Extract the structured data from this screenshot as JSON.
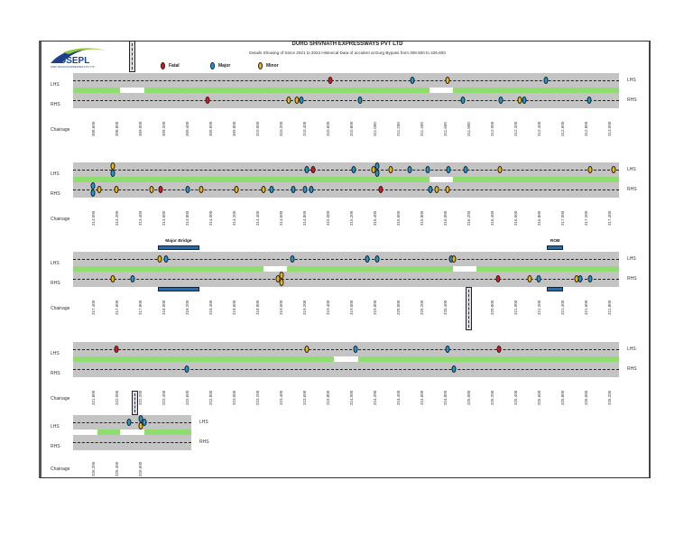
{
  "header": {
    "title": "DURG SHIVNATH EXPRESSWAYS PVT LTD",
    "subtitle": "Details Showing of Since 2021 to 2024 Historical Data of accident at Durg Bypass from 308.600 to 326.600",
    "logo_text": "DSEPL",
    "logo_tagline": "DURG SHIVNATH EXPRESSWAYS PVT LTD"
  },
  "legend": [
    {
      "key": "fatal",
      "label": "Fatal",
      "color": "#e8101e"
    },
    {
      "key": "major",
      "label": "Major",
      "color": "#1a9ad8"
    },
    {
      "key": "minor",
      "label": "Minor",
      "color": "#f2b900"
    }
  ],
  "labels": {
    "lhs": "LHS",
    "rhs": "RHS",
    "chainage": "Chainage"
  },
  "rows": [
    {
      "start": 308.6,
      "ticks": [
        "308.600",
        "308.800",
        "309.000",
        "309.200",
        "309.400",
        "309.600",
        "309.800",
        "310.000",
        "310.200",
        "310.400",
        "310.600",
        "310.800",
        "311.000",
        "311.200",
        "311.400",
        "311.600",
        "311.800",
        "312.000",
        "312.200",
        "312.400",
        "312.600",
        "312.800",
        "313.000"
      ],
      "median_openings": [
        [
          308.83,
          309.04
        ],
        [
          311.47,
          311.67
        ]
      ],
      "lhs": [
        [
          "fatal",
          310.62
        ],
        [
          "major",
          311.32
        ],
        [
          "minor",
          311.62
        ],
        [
          "major",
          312.46
        ]
      ],
      "rhs": [
        [
          "fatal",
          309.58
        ],
        [
          "minor",
          310.27
        ],
        [
          "minor",
          310.34
        ],
        [
          "major",
          310.38
        ],
        [
          "major",
          310.88
        ],
        [
          "major",
          311.75
        ],
        [
          "major",
          312.08
        ],
        [
          "minor",
          312.24
        ],
        [
          "major",
          312.28
        ],
        [
          "major",
          312.83
        ]
      ]
    },
    {
      "start": 313.0,
      "ticks": [
        "313.000",
        "313.200",
        "313.400",
        "313.600",
        "313.800",
        "314.000",
        "314.200",
        "314.400",
        "314.600",
        "314.800",
        "315.000",
        "315.200",
        "315.400",
        "315.600",
        "315.800",
        "316.000",
        "316.200",
        "316.400",
        "316.600",
        "316.800",
        "317.000",
        "317.200",
        "317.400"
      ],
      "median_openings": [
        [
          315.87,
          316.07
        ]
      ],
      "lhs": [
        [
          "minor",
          313.17
        ],
        [
          "major",
          313.17
        ],
        [
          "major",
          314.82
        ],
        [
          "fatal",
          314.88
        ],
        [
          "major",
          315.22
        ],
        [
          "minor",
          315.39
        ],
        [
          "major",
          315.42
        ],
        [
          "major",
          315.42
        ],
        [
          "minor",
          315.54
        ],
        [
          "major",
          315.7
        ],
        [
          "major",
          315.85
        ],
        [
          "major",
          316.03
        ],
        [
          "major",
          316.18
        ],
        [
          "minor",
          316.47
        ],
        [
          "minor",
          317.24
        ],
        [
          "minor",
          317.44
        ]
      ],
      "rhs": [
        [
          "major",
          313.0
        ],
        [
          "major",
          313.0
        ],
        [
          "minor",
          313.05
        ],
        [
          "minor",
          313.2
        ],
        [
          "minor",
          313.5
        ],
        [
          "fatal",
          313.58
        ],
        [
          "major",
          313.81
        ],
        [
          "minor",
          313.92
        ],
        [
          "minor",
          314.22
        ],
        [
          "minor",
          314.45
        ],
        [
          "major",
          314.52
        ],
        [
          "major",
          314.71
        ],
        [
          "major",
          314.81
        ],
        [
          "major",
          314.86
        ],
        [
          "fatal",
          315.45
        ],
        [
          "major",
          315.88
        ],
        [
          "minor",
          315.93
        ],
        [
          "minor",
          316.02
        ]
      ]
    },
    {
      "start": 317.4,
      "ticks": [
        "317.400",
        "317.600",
        "317.800",
        "318.000",
        "318.200",
        "318.400",
        "318.600",
        "318.800",
        "319.000",
        "319.200",
        "319.400",
        "319.600",
        "319.800",
        "320.000",
        "320.200",
        "320.400",
        "320.600",
        "320.800",
        "321.000",
        "321.200",
        "321.400",
        "321.600",
        "321.800"
      ],
      "median_openings": [
        [
          318.85,
          319.05
        ],
        [
          320.47,
          320.67
        ]
      ],
      "structures": [
        {
          "label": "Major Bridge",
          "from": 317.95,
          "to": 318.31
        },
        {
          "label": "ROB",
          "from": 321.27,
          "to": 321.41
        }
      ],
      "lhs": [
        [
          "minor",
          317.97
        ],
        [
          "major",
          318.02
        ],
        [
          "major",
          319.1
        ],
        [
          "major",
          319.74
        ],
        [
          "major",
          319.82
        ],
        [
          "major",
          320.45
        ],
        [
          "minor",
          320.48
        ]
      ],
      "rhs": [
        [
          "minor",
          317.57
        ],
        [
          "major",
          317.74
        ],
        [
          "minor",
          318.98
        ],
        [
          "minor",
          319.01
        ],
        [
          "minor",
          319.01
        ],
        [
          "fatal",
          320.85
        ],
        [
          "minor",
          321.12
        ],
        [
          "major",
          321.2
        ],
        [
          "minor",
          321.52
        ],
        [
          "major",
          321.55
        ],
        [
          "major",
          321.64
        ]
      ]
    },
    {
      "start": 321.8,
      "ticks": [
        "321.800",
        "322.000",
        "322.200",
        "322.400",
        "322.600",
        "322.800",
        "323.000",
        "323.200",
        "323.400",
        "323.600",
        "323.800",
        "324.000",
        "324.200",
        "324.400",
        "324.600",
        "324.800",
        "325.000",
        "325.200",
        "325.400",
        "325.600",
        "325.800",
        "326.000",
        "326.200"
      ],
      "median_openings": [
        [
          323.85,
          324.06
        ]
      ],
      "lhs": [
        [
          "fatal",
          322.0
        ],
        [
          "minor",
          323.62
        ],
        [
          "major",
          324.04
        ],
        [
          "major",
          324.82
        ],
        [
          "fatal",
          325.26
        ]
      ],
      "rhs": [
        [
          "major",
          322.6
        ],
        [
          "major",
          324.88
        ]
      ]
    },
    {
      "start": 326.2,
      "ticks": [
        "326.200",
        "326.400",
        "326.600"
      ],
      "short": true,
      "median_openings": [
        [
          326.03,
          326.24
        ],
        [
          326.43,
          326.64
        ]
      ],
      "lhs": [
        [
          "major",
          326.51
        ],
        [
          "major",
          326.61
        ],
        [
          "minor",
          326.61
        ],
        [
          "major",
          326.64
        ]
      ],
      "rhs": []
    }
  ]
}
